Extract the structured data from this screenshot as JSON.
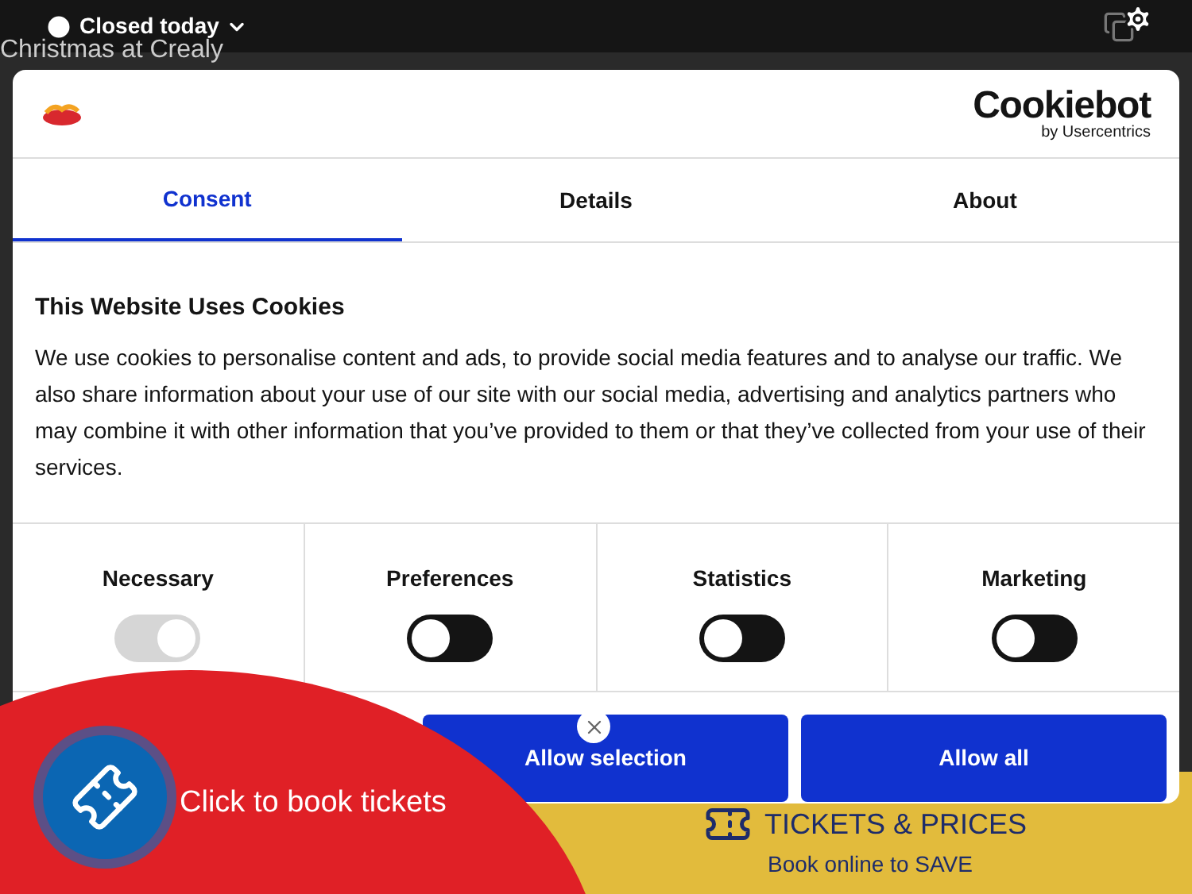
{
  "top_bar": {
    "hours": "Closed today",
    "site_title": "Christmas at Crealy"
  },
  "banner": {
    "title": "TICKETS & PRICES",
    "subtitle": "Book online to SAVE"
  },
  "dialog": {
    "brand": {
      "name": "Cookiebot",
      "tagline": "by Usercentrics"
    },
    "tabs": [
      {
        "label": "Consent",
        "selected": true
      },
      {
        "label": "Details",
        "selected": false
      },
      {
        "label": "About",
        "selected": false
      }
    ],
    "heading": "This Website Uses Cookies",
    "body": "We use cookies to personalise content and ads, to provide social media features and to analyse our traffic. We also share information about your use of our site with our social media, advertising and analytics partners who may combine it with other information that you’ve provided to them or that they’ve collected from your use of their services.",
    "categories": [
      {
        "label": "Necessary",
        "on": true,
        "disabled": true
      },
      {
        "label": "Preferences",
        "on": false,
        "disabled": false
      },
      {
        "label": "Statistics",
        "on": false,
        "disabled": false
      },
      {
        "label": "Marketing",
        "on": false,
        "disabled": false
      }
    ],
    "buttons": [
      "Allow selection",
      "Allow all"
    ]
  },
  "booking": {
    "label": "Click to book tickets"
  }
}
